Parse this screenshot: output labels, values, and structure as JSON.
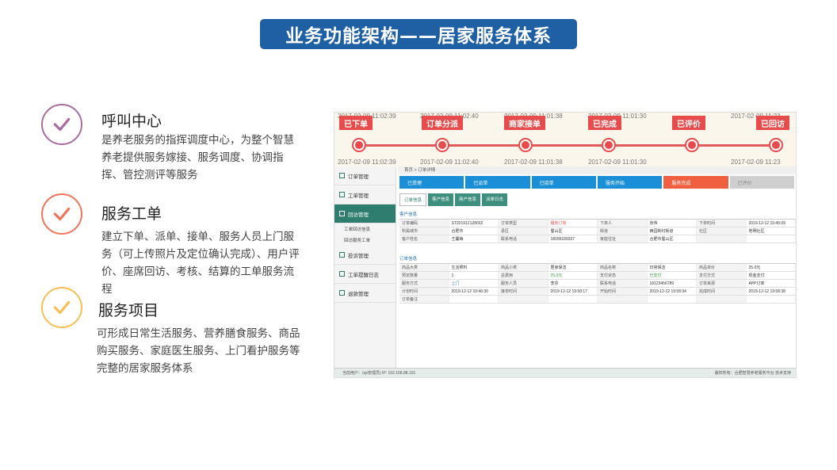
{
  "header": {
    "title": "业务功能架构——居家服务体系"
  },
  "features": [
    {
      "title": "呼叫中心",
      "desc": "是养老服务的指挥调度中心，为整个智慧养老提供服务嫁接、服务调度、协调指挥、管控测评等服务",
      "color": "#a86da0"
    },
    {
      "title": "服务工单",
      "desc": "建立下单、派单、接单、服务人员上门服务（可上传照片及定位确认完成）、用户评价、座席回访、考核、结算的工单服务流程",
      "color": "#f0735c"
    },
    {
      "title": "服务项目",
      "desc": "可形成日常生活服务、营养膳食服务、商品购买服务、家庭医生服务、上门看护服务等完整的居家服务体系",
      "color": "#f5bf55"
    }
  ],
  "timeline": {
    "stages": [
      {
        "label": "已下单",
        "date_top": "2017-02-09 11:02:39",
        "date_bottom": "2017-02-09 11:02:39"
      },
      {
        "label": "订单分派",
        "date_top": "2017-02-09 11:02:40",
        "date_bottom": "2017-02-09 11:02:40"
      },
      {
        "label": "商家接单",
        "date_top": "2017-02-09 11:01:38",
        "date_bottom": "2017-02-09 11:01:38"
      },
      {
        "label": "已完成",
        "date_top": "2017-02-09 11:01:30",
        "date_bottom": "2017-02-09 11:01:30"
      },
      {
        "label": "已评价",
        "date_top": "",
        "date_bottom": ""
      },
      {
        "label": "已回访",
        "date_top": "2017-02-09 11:23",
        "date_bottom": "2017-02-09 11:23"
      }
    ]
  },
  "sidebar": {
    "items": [
      "订单管理",
      "工单管理",
      "回访管理",
      "投诉管理",
      "工单提醒日志",
      "退款管理"
    ],
    "subitems": [
      "工单回访信息",
      "回访服务工单"
    ]
  },
  "main": {
    "crumb": "首页 > 订单详情",
    "steps": [
      "已受理",
      "已派单",
      "已接单",
      "服务开始",
      "服务完成",
      "已评价"
    ],
    "tabs": [
      "订单信息",
      "客户信息",
      "商户信息",
      "派单日志"
    ],
    "section1": "客户信息",
    "section2": "订单信息",
    "grid1": [
      [
        "订单编码",
        "ST201912128002",
        "订单类型",
        "服务订单",
        "下单人",
        "张伟",
        "下单时间",
        "2019-12-12 10:45:09"
      ],
      [
        "所属城市",
        "合肥市",
        "县区",
        "蜀山区",
        "街道",
        "西园新村街道",
        "社区",
        "地明社区"
      ],
      [
        "客户姓名",
        "王馨梅",
        "联系电话",
        "18095189337",
        "家庭住址",
        "合肥市蜀山区",
        "",
        ""
      ]
    ],
    "grid2": [
      [
        "商品大类",
        "生活照料",
        "商品小类",
        "居家保洁",
        "商品名称",
        "日常保洁",
        "商品单价",
        "25.0元"
      ],
      [
        "预定数量",
        "1",
        "总费用",
        "25.0元",
        "支付状态",
        "已支付",
        "支付方式",
        "现金支付"
      ],
      [
        "服务方式",
        "上门",
        "服务人员",
        "李芬",
        "联系电话",
        "18123456789",
        "订单来源",
        "APP订单"
      ],
      [
        "计划时间",
        "2019-12-12 10:46:30",
        "接单时间",
        "2019-12-12 19:58:17",
        "开始时间",
        "2019-12-12 19:58:34",
        "完成时间",
        "2019-12-12 19:58:38"
      ],
      [
        "订单备注",
        "",
        "",
        "",
        "",
        "",
        "",
        ""
      ]
    ]
  },
  "status_bar": {
    "left": "当前用户：(sp管理员)   IP: 192.168.88.101   ",
    "right": "版权所有：合肥智慧养老服务平台   技术支持"
  },
  "colors": {
    "title_bg": "#1f5fa3",
    "accent_red": "#e84b4b",
    "step_blue": "#1a8fd8",
    "step_red": "#f06040",
    "step_gray": "#cfcfcf"
  }
}
